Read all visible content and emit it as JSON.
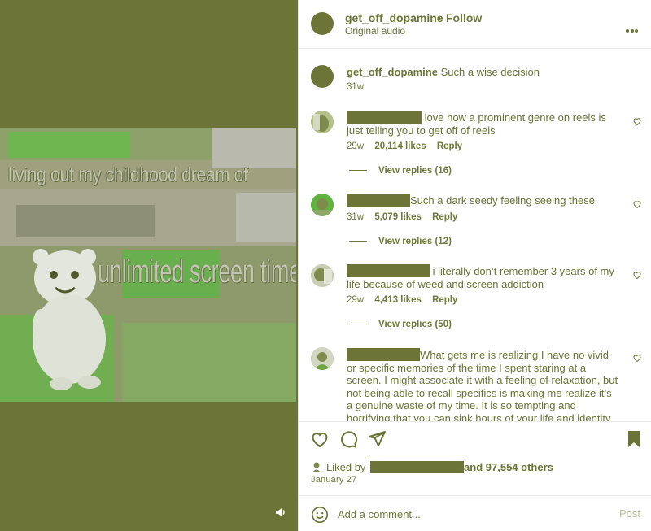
{
  "colors": {
    "accent": "#6d7438",
    "text": "#6b7436",
    "muted": "#6f7a3a"
  },
  "video": {
    "caption_top": "living out my childhood dream of",
    "caption_bottom": "unlimited screen time",
    "volume_icon": "volume-icon"
  },
  "header": {
    "username": "get_off_dopamine",
    "separator": "•",
    "follow_label": "Follow",
    "audio": "Original audio",
    "more_icon": "more-options-icon"
  },
  "caption": {
    "username": "get_off_dopamine",
    "text": "Such a wise decision",
    "time": "31w"
  },
  "comments": [
    {
      "text": "love how a prominent genre on reels is just telling you to get off of reels",
      "time": "29w",
      "likes": "20,114 likes",
      "reply_label": "Reply",
      "view_replies": "View replies (16)"
    },
    {
      "text": "Such a dark seedy feeling seeing these",
      "time": "31w",
      "likes": "5,079 likes",
      "reply_label": "Reply",
      "view_replies": "View replies (12)"
    },
    {
      "text": "i literally don’t remember 3 years of my life because of weed and screen addiction",
      "time": "29w",
      "likes": "4,413 likes",
      "reply_label": "Reply",
      "view_replies": "View replies (50)"
    },
    {
      "text": "What gets me is realizing I have no vivid or specific memories of the time I spent staring at a screen. I might associate it with a feeling of relaxation, but not being able to recall specifics is making me realize it’s a genuine waste of my time. It is so tempting and horrifying that you can sink hours of your life and identity into a screen and"
    }
  ],
  "likes": {
    "prefix": "Liked by",
    "suffix": "and 97,554 others"
  },
  "date": "January 27",
  "comment_box": {
    "placeholder": "Add a comment...",
    "post_label": "Post"
  }
}
